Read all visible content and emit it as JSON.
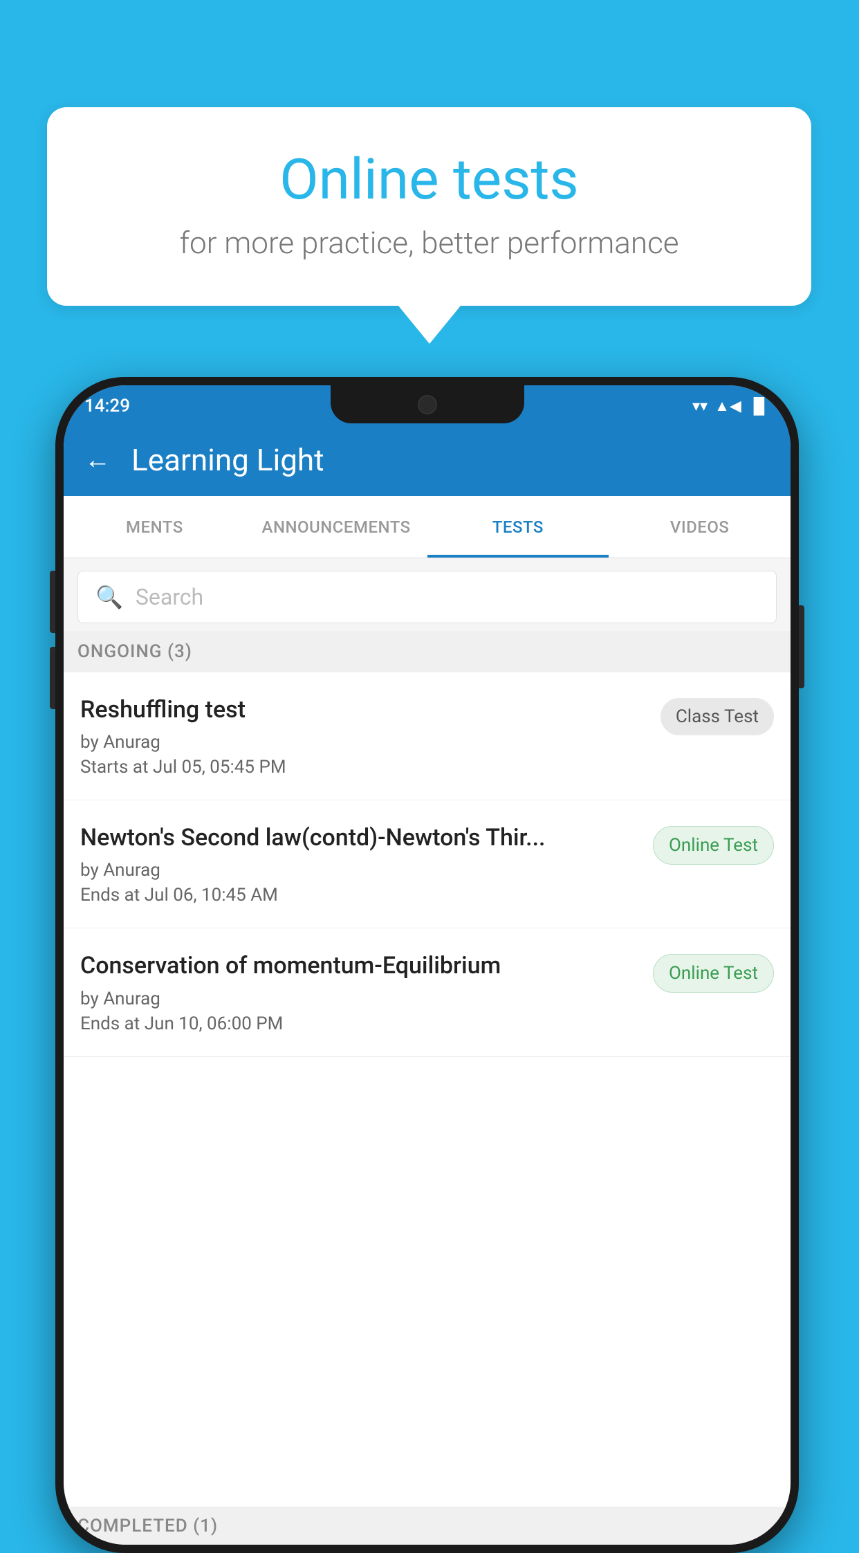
{
  "background_color": "#29b6e8",
  "speech_bubble": {
    "title": "Online tests",
    "subtitle": "for more practice, better performance"
  },
  "phone": {
    "status_bar": {
      "time": "14:29",
      "wifi_icon": "▾",
      "signal_icon": "▲",
      "battery_icon": "▐"
    },
    "header": {
      "back_label": "←",
      "title": "Learning Light"
    },
    "tabs": [
      {
        "label": "MENTS",
        "active": false
      },
      {
        "label": "ANNOUNCEMENTS",
        "active": false
      },
      {
        "label": "TESTS",
        "active": true
      },
      {
        "label": "VIDEOS",
        "active": false
      }
    ],
    "search": {
      "placeholder": "Search"
    },
    "section_ongoing": {
      "label": "ONGOING (3)"
    },
    "tests": [
      {
        "title": "Reshuffling test",
        "author": "by Anurag",
        "date_label": "Starts at",
        "date": "Jul 05, 05:45 PM",
        "badge": "Class Test",
        "badge_type": "class"
      },
      {
        "title": "Newton's Second law(contd)-Newton's Thir...",
        "author": "by Anurag",
        "date_label": "Ends at",
        "date": "Jul 06, 10:45 AM",
        "badge": "Online Test",
        "badge_type": "online"
      },
      {
        "title": "Conservation of momentum-Equilibrium",
        "author": "by Anurag",
        "date_label": "Ends at",
        "date": "Jun 10, 06:00 PM",
        "badge": "Online Test",
        "badge_type": "online"
      }
    ],
    "section_completed": {
      "label": "COMPLETED (1)"
    }
  }
}
